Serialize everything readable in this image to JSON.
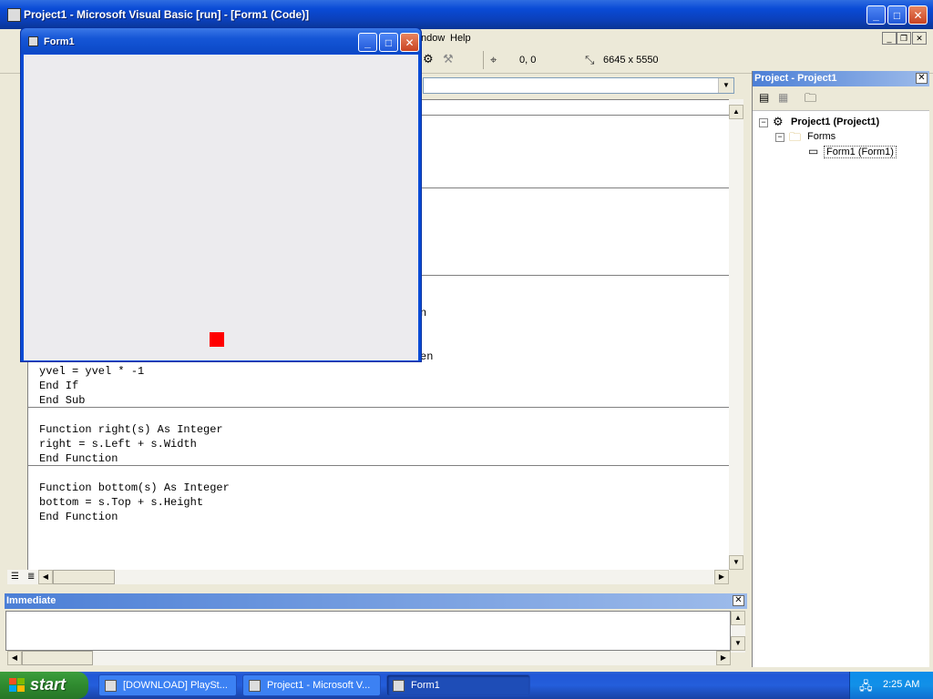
{
  "vb_window": {
    "title": "Project1 - Microsoft Visual Basic [run] - [Form1 (Code)]"
  },
  "menubar": {
    "items": [
      "ndow",
      "Help"
    ]
  },
  "toolbar": {
    "position_readout": "0, 0",
    "size_readout": "6645 x 5550"
  },
  "code": {
    "partial_lines": [
      "n",
      "en"
    ],
    "lines": [
      "yvel = yvel * -1",
      "End If",
      "End Sub",
      "",
      "Function right(s) As Integer",
      "right = s.Left + s.Width",
      "End Function",
      "",
      "Function bottom(s) As Integer",
      "bottom = s.Top + s.Height",
      "End Function"
    ]
  },
  "project_explorer": {
    "title": "Project - Project1",
    "tree": {
      "root": "Project1 (Project1)",
      "folder": "Forms",
      "item": "Form1 (Form1)"
    }
  },
  "immediate": {
    "title": "Immediate"
  },
  "form1": {
    "title": "Form1",
    "square_color": "#FF0000"
  },
  "taskbar": {
    "start_label": "start",
    "items": [
      "[DOWNLOAD] PlaySt...",
      "Project1 - Microsoft V...",
      "Form1"
    ],
    "clock": "2:25 AM"
  }
}
